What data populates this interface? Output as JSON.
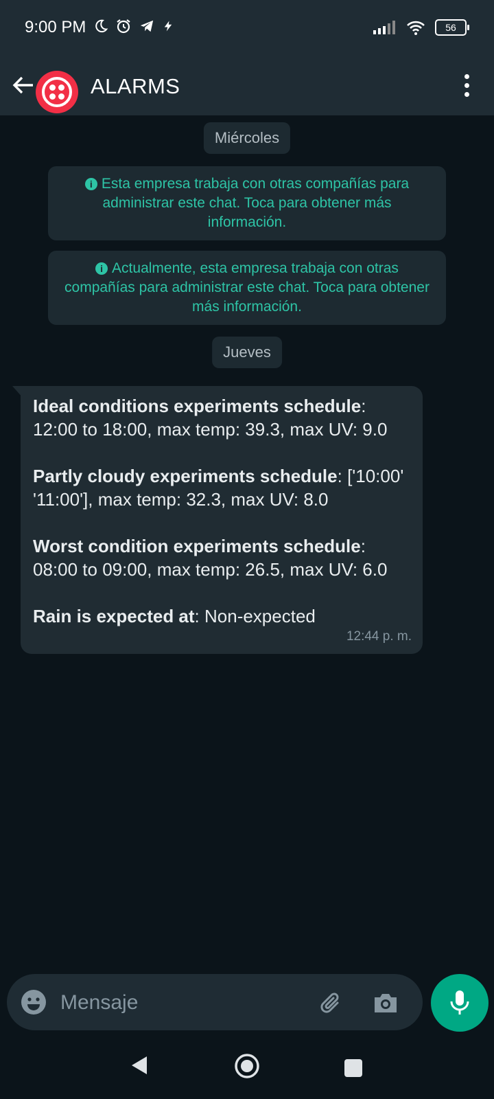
{
  "status_bar": {
    "time": "9:00 PM",
    "battery": "56",
    "icons": [
      "moon-icon",
      "alarm-icon",
      "telegram-icon",
      "bolt-icon",
      "signal-icon",
      "wifi-icon",
      "battery-icon"
    ]
  },
  "header": {
    "title": "ALARMS",
    "avatar_color": "#f22f46"
  },
  "chat": {
    "date_1": "Miércoles",
    "system_messages": [
      "Esta empresa trabaja con otras compañías para administrar este chat. Toca para obtener más información.",
      "Actualmente, esta empresa trabaja con otras compañías para administrar este chat. Toca para obtener más información."
    ],
    "date_2": "Jueves",
    "message": {
      "sections": [
        {
          "label": "Ideal conditions experiments schedule",
          "text": ": 12:00 to 18:00, max temp: 39.3, max UV: 9.0"
        },
        {
          "label": "Partly cloudy experiments schedule",
          "text": ": ['10:00' '11:00'], max temp: 32.3, max UV: 8.0"
        },
        {
          "label": "Worst condition experiments schedule",
          "text": ": 08:00 to 09:00, max temp: 26.5, max UV: 6.0"
        },
        {
          "label": "Rain is expected at",
          "text": ": Non-expected"
        }
      ],
      "time": "12:44 p. m."
    }
  },
  "input": {
    "placeholder": "Mensaje"
  },
  "colors": {
    "accent": "#00a884",
    "system_text": "#2ec4a6",
    "bubble": "#202c33"
  }
}
